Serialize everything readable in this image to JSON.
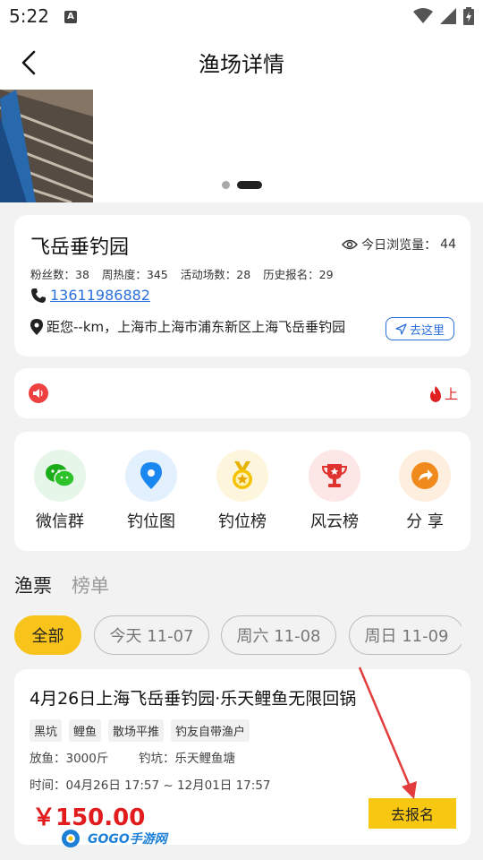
{
  "status_bar": {
    "time": "5:22",
    "notification_letter": "A"
  },
  "nav": {
    "title": "渔场详情"
  },
  "banner": {
    "dots": 2,
    "active_dot": 1
  },
  "venue": {
    "name": "飞岳垂钓园",
    "views_label": "今日浏览量：",
    "views_value": "44",
    "fans": "粉丝数：38",
    "weekly_heat": "周热度：345",
    "activity_count": "活动场数：28",
    "history_signups": "历史报名：29",
    "phone": "13611986882",
    "address": "距您--km，上海市上海市浦东新区上海飞岳垂钓园",
    "go_label": "去这里"
  },
  "notice": {
    "hot_text": "上"
  },
  "menu": [
    {
      "label": "微信群",
      "icon": "wechat-icon",
      "color": "#1aad19",
      "bg": "#e6f6e8"
    },
    {
      "label": "钓位图",
      "icon": "map-pin-icon",
      "color": "#1a86f0",
      "bg": "#e3f0fd"
    },
    {
      "label": "钓位榜",
      "icon": "medal-icon",
      "color": "#e8b300",
      "bg": "#fdf6dc"
    },
    {
      "label": "风云榜",
      "icon": "trophy-icon",
      "color": "#e0332f",
      "bg": "#fde6e6"
    },
    {
      "label": "分 享",
      "icon": "share-icon",
      "color": "#f08a1c",
      "bg": "#fdeedd"
    }
  ],
  "tabs": [
    {
      "label": "渔票",
      "active": true
    },
    {
      "label": "榜单",
      "active": false
    }
  ],
  "filters": [
    {
      "label": "全部",
      "active": true
    },
    {
      "label": "今天 11-07",
      "active": false
    },
    {
      "label": "周六 11-08",
      "active": false
    },
    {
      "label": "周日 11-09",
      "active": false
    }
  ],
  "ticket": {
    "title": "4月26日上海飞岳垂钓园·乐天鲤鱼无限回锅",
    "tags": [
      "黑坑",
      "鲤鱼",
      "散场平推",
      "钓友自带渔户"
    ],
    "fish_release": "放鱼：3000斤",
    "pond": "钓坑：乐天鲤鱼塘",
    "time": "时间：04月26日 17:57 ~ 12月01日 17:57",
    "price": "￥150.00",
    "signup_label": "去报名"
  },
  "watermark": {
    "text": "GOGO手游网"
  },
  "colors": {
    "accent_yellow": "#f8c31a",
    "link_blue": "#2a6fdb",
    "price_red": "#e21c1c",
    "arrow_red": "#e23c3c"
  }
}
